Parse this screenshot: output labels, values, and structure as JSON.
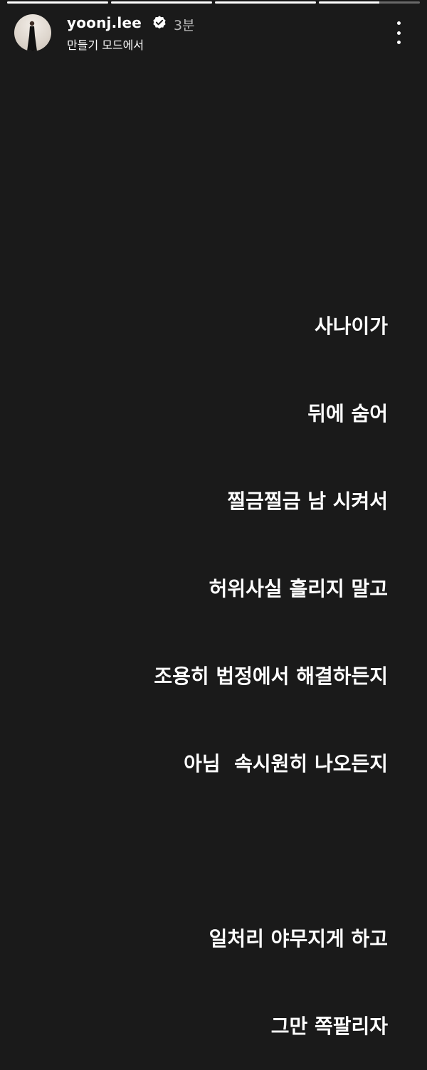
{
  "progress": [
    {
      "fill": 1.0
    },
    {
      "fill": 1.0
    },
    {
      "fill": 1.0
    },
    {
      "fill": 0.6
    }
  ],
  "header": {
    "username": "yoonj.lee",
    "time": "3분",
    "subtitle": "만들기 모드에서",
    "verified_icon": "verified-badge-icon",
    "more_icon": "more-vertical-icon"
  },
  "story": {
    "lines": [
      "사나이가",
      "뒤에 숨어",
      "찔금찔금 남 시켜서",
      "허위사실 흘리지 말고",
      "조용히 법정에서 해결하든지",
      "아님  속시원히 나오든지",
      "",
      "일처리 야무지게 하고",
      "그만 쪽팔리자"
    ]
  },
  "colors": {
    "background": "#1a1a1a",
    "text": "#ffffff"
  }
}
